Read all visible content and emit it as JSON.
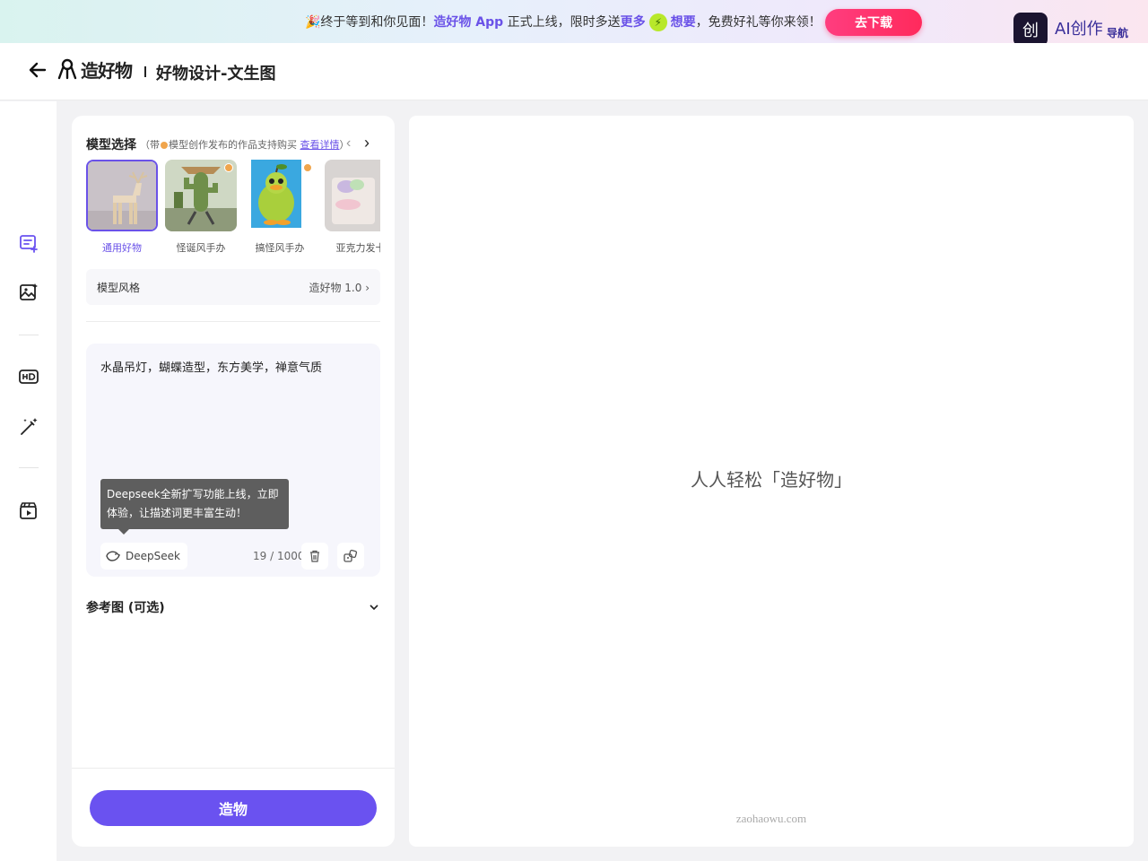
{
  "banner": {
    "prefix": "🎉终于等到和你见面！",
    "app_name": "造好物 App",
    "mid1": " 正式上线，限时多送",
    "more": "更多",
    "bolt": "⚡",
    "want": "想要",
    "suffix": "，免费好礼等你来领！",
    "download_label": "去下载",
    "ai_logo": "创",
    "ai_brand": "AI创作",
    "ai_sub": "导航"
  },
  "header": {
    "logo_text": "造好物",
    "page_title": "好物设计-文生图"
  },
  "model_section": {
    "title": "模型选择",
    "note_prefix": "（带",
    "note_mid": "模型创作发布的作品支持购买 ",
    "note_link": "查看详情",
    "note_suffix": "）",
    "prev": "‹",
    "next": "›",
    "models": [
      {
        "label": "通用好物",
        "selected": true
      },
      {
        "label": "怪诞风手办",
        "selected": false
      },
      {
        "label": "搞怪风手办",
        "selected": false
      },
      {
        "label": "亚克力发卡",
        "selected": false
      }
    ]
  },
  "style_row": {
    "label": "模型风格",
    "value": "造好物 1.0",
    "chevron": "›"
  },
  "prompt": {
    "text": "水晶吊灯，蝴蝶造型，东方美学，禅意气质",
    "tooltip": "Deepseek全新扩写功能上线，立即体验，让描述词更丰富生动！",
    "deepseek_label": "DeepSeek",
    "counter": "19 / 1000"
  },
  "reference": {
    "label": "参考图 (可选)",
    "chevron": "⌄"
  },
  "create_button": "造物",
  "canvas": {
    "slogan": "人人轻松「造好物」",
    "domain": "zaohaowu.com"
  },
  "colors": {
    "accent": "#6a52f0",
    "download": "#ff2a5c"
  }
}
